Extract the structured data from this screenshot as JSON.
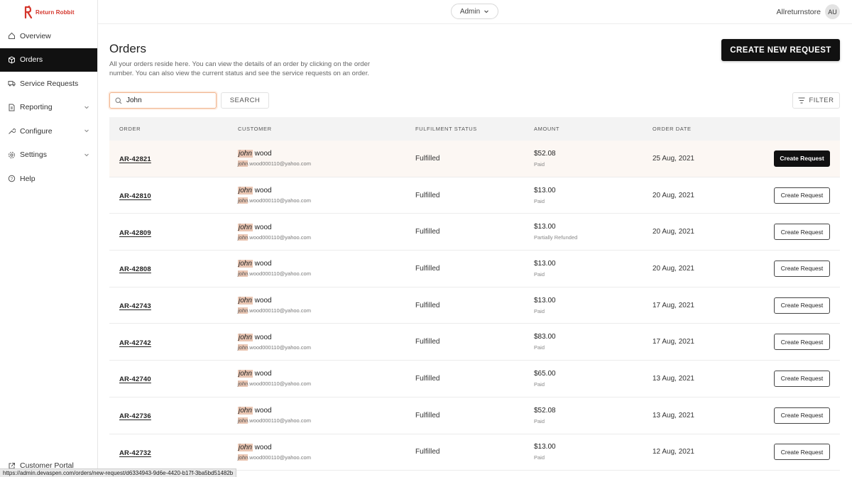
{
  "brand": {
    "name": "Return Robbit",
    "color": "#d4352b"
  },
  "sidebar": {
    "items": [
      {
        "label": "Overview",
        "icon": "home-icon",
        "expandable": false
      },
      {
        "label": "Orders",
        "icon": "box-icon",
        "expandable": false,
        "active": true
      },
      {
        "label": "Service Requests",
        "icon": "returns-icon",
        "expandable": false
      },
      {
        "label": "Reporting",
        "icon": "report-icon",
        "expandable": true
      },
      {
        "label": "Configure",
        "icon": "wrench-icon",
        "expandable": true
      },
      {
        "label": "Settings",
        "icon": "gear-icon",
        "expandable": true
      },
      {
        "label": "Help",
        "icon": "help-icon",
        "expandable": false
      }
    ],
    "portal_label": "Customer Portal"
  },
  "header": {
    "role": "Admin",
    "store": "Allreturnstore",
    "avatar": "AU"
  },
  "main": {
    "title": "Orders",
    "description": "All your orders reside here. You can view the details of an order by clicking on the order number. You can also view the current status and see the service requests on an order.",
    "create_label": "CREATE NEW REQUEST",
    "search_value": "John",
    "search_label": "SEARCH",
    "filter_label": "FILTER"
  },
  "table": {
    "columns": [
      "ORDER",
      "CUSTOMER",
      "FULFILMENT STATUS",
      "AMOUNT",
      "ORDER DATE"
    ],
    "action_label": "Create Request",
    "rows": [
      {
        "order": "AR-42821",
        "name_hl": "john",
        "name_rest": " wood",
        "email_hl": "john",
        "email_rest": ".wood000110@yahoo.com",
        "status": "Fulfilled",
        "amount": "$52.08",
        "payment": "Paid",
        "date": "25 Aug, 2021"
      },
      {
        "order": "AR-42810",
        "name_hl": "john",
        "name_rest": " wood",
        "email_hl": "john",
        "email_rest": ".wood000110@yahoo.com",
        "status": "Fulfilled",
        "amount": "$13.00",
        "payment": "Paid",
        "date": "20 Aug, 2021"
      },
      {
        "order": "AR-42809",
        "name_hl": "john",
        "name_rest": " wood",
        "email_hl": "john",
        "email_rest": ".wood000110@yahoo.com",
        "status": "Fulfilled",
        "amount": "$13.00",
        "payment": "Partially Refunded",
        "date": "20 Aug, 2021"
      },
      {
        "order": "AR-42808",
        "name_hl": "john",
        "name_rest": " wood",
        "email_hl": "john",
        "email_rest": ".wood000110@yahoo.com",
        "status": "Fulfilled",
        "amount": "$13.00",
        "payment": "Paid",
        "date": "20 Aug, 2021"
      },
      {
        "order": "AR-42743",
        "name_hl": "john",
        "name_rest": " wood",
        "email_hl": "john",
        "email_rest": ".wood000110@yahoo.com",
        "status": "Fulfilled",
        "amount": "$13.00",
        "payment": "Paid",
        "date": "17 Aug, 2021"
      },
      {
        "order": "AR-42742",
        "name_hl": "john",
        "name_rest": " wood",
        "email_hl": "john",
        "email_rest": ".wood000110@yahoo.com",
        "status": "Fulfilled",
        "amount": "$83.00",
        "payment": "Paid",
        "date": "17 Aug, 2021"
      },
      {
        "order": "AR-42740",
        "name_hl": "john",
        "name_rest": " wood",
        "email_hl": "john",
        "email_rest": ".wood000110@yahoo.com",
        "status": "Fulfilled",
        "amount": "$65.00",
        "payment": "Paid",
        "date": "13 Aug, 2021"
      },
      {
        "order": "AR-42736",
        "name_hl": "john",
        "name_rest": " wood",
        "email_hl": "john",
        "email_rest": ".wood000110@yahoo.com",
        "status": "Fulfilled",
        "amount": "$52.08",
        "payment": "Paid",
        "date": "13 Aug, 2021"
      },
      {
        "order": "AR-42732",
        "name_hl": "john",
        "name_rest": " wood",
        "email_hl": "john",
        "email_rest": ".wood000110@yahoo.com",
        "status": "Fulfilled",
        "amount": "$13.00",
        "payment": "Paid",
        "date": "12 Aug, 2021"
      }
    ]
  },
  "statusbar": {
    "url": "https://admin.devaspen.com/orders/new-request/d6334943-9d6e-4420-b17f-3ba5bd51482b"
  }
}
